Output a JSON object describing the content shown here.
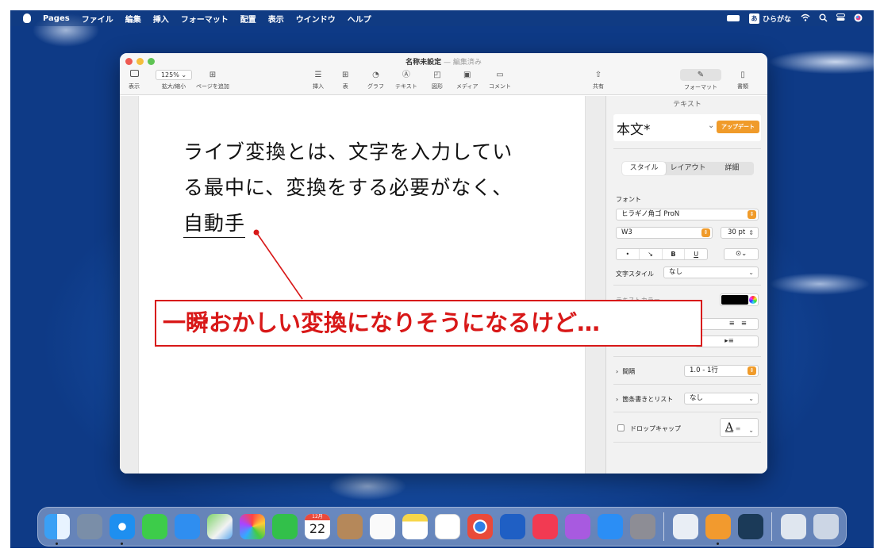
{
  "menubar": {
    "app": "Pages",
    "items": [
      "ファイル",
      "編集",
      "挿入",
      "フォーマット",
      "配置",
      "表示",
      "ウインドウ",
      "ヘルプ"
    ],
    "ime_badge": "あ",
    "ime_label": "ひらがな"
  },
  "window": {
    "title": "名称未設定",
    "status": "— 編集済み",
    "toolbar": {
      "view": "表示",
      "zoom_value": "125%",
      "zoom": "拡大/縮小",
      "add_page": "ページを追加",
      "insert": "挿入",
      "table": "表",
      "chart": "グラフ",
      "text": "テキスト",
      "shape": "図形",
      "media": "メディア",
      "comment": "コメント",
      "share": "共有",
      "format": "フォーマット",
      "document": "書類"
    }
  },
  "document": {
    "lines": [
      "ライブ変換とは、文字を入力してい",
      "る最中に、変換をする必要がなく、"
    ],
    "typing": "自動手"
  },
  "sidebar": {
    "header": "テキスト",
    "paragraph_style": "本文*",
    "update_button": "アップデート",
    "tabs": [
      "スタイル",
      "レイアウト",
      "詳細"
    ],
    "font_label": "フォント",
    "font_family": "ヒラギノ角ゴ ProN",
    "font_weight": "W3",
    "font_size": "30 pt",
    "bold": "B",
    "underline": "U",
    "char_style_label": "文字スタイル",
    "char_style_value": "なし",
    "text_color_label": "テキストカラー",
    "spacing_label": "間隔",
    "spacing_value": "1.0 - 1行",
    "bullets_label": "箇条書きとリスト",
    "bullets_value": "なし",
    "dropcap_label": "ドロップキャップ",
    "dropcap_preview": "A"
  },
  "annotation": {
    "text": "一瞬おかしい変換になりそうになるけど…",
    "color": "#d81818"
  },
  "dock": {
    "calendar_month": "12月",
    "calendar_day": "22"
  }
}
